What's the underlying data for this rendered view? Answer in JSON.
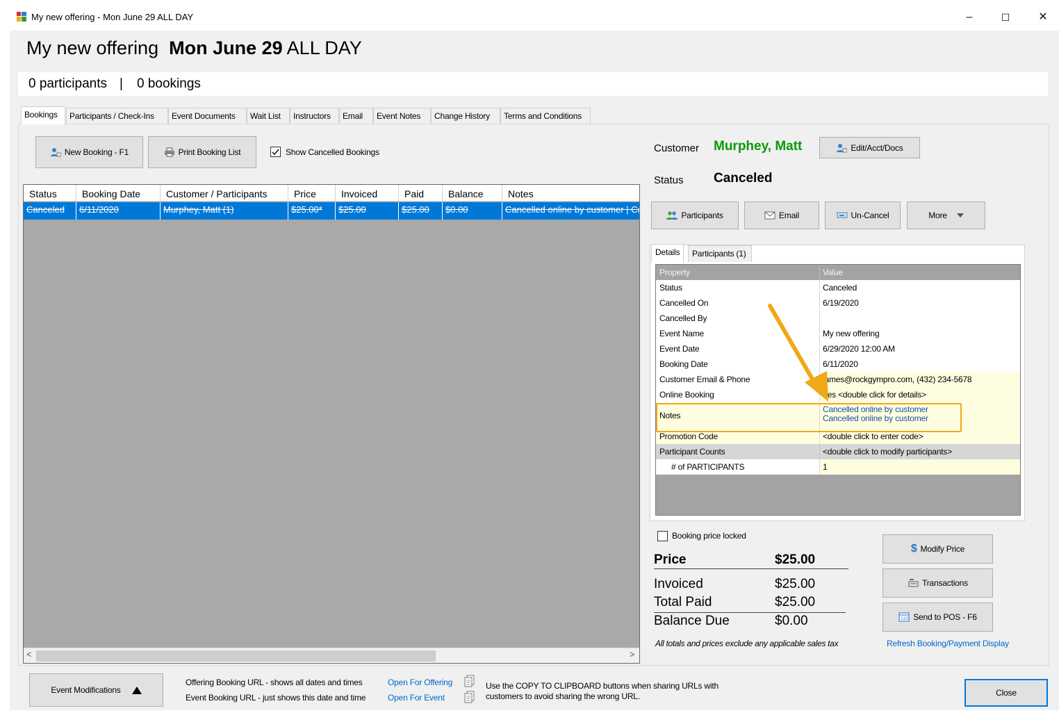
{
  "window": {
    "title": "My new offering - Mon June 29 ALL DAY",
    "minimize": "–",
    "maximize": "☐",
    "close": "✕"
  },
  "header": {
    "offering_name": "My new offering",
    "date": "Mon June 29",
    "time": "ALL DAY",
    "participants_count": "0 participants",
    "separator": "|",
    "bookings_count": "0 bookings"
  },
  "tabs": [
    "Bookings",
    "Participants / Check-Ins",
    "Event Documents",
    "Wait List",
    "Instructors",
    "Email",
    "Event Notes",
    "Change History",
    "Terms and Conditions"
  ],
  "toolbar": {
    "new_booking": "New Booking - F1",
    "print_list": "Print Booking List",
    "show_cancelled": "Show Cancelled Bookings",
    "show_cancelled_checked": true
  },
  "bookings_grid": {
    "columns": [
      "Status",
      "Booking Date",
      "Customer / Participants",
      "Price",
      "Invoiced",
      "Paid",
      "Balance",
      "Notes"
    ],
    "rows": [
      [
        "Canceled",
        "6/11/2020",
        "Murphey, Matt (1)",
        "$25.00*",
        "$25.00",
        "$25.00",
        "$0.00",
        "Cancelled online by customer | Cancelled online by customer"
      ]
    ]
  },
  "customer": {
    "label": "Customer",
    "name": "Murphey, Matt",
    "edit_button": "Edit/Acct/Docs",
    "status_label": "Status",
    "status": "Canceled"
  },
  "actions": {
    "participants": "Participants",
    "email": "Email",
    "uncancel": "Un-Cancel",
    "more": "More"
  },
  "detail_tabs": [
    "Details",
    "Participants (1)"
  ],
  "properties": {
    "header_property": "Property",
    "header_value": "Value",
    "rows": [
      {
        "k": "Status",
        "v": "Canceled"
      },
      {
        "k": "Cancelled On",
        "v": "6/19/2020"
      },
      {
        "k": "Cancelled By",
        "v": ""
      },
      {
        "k": "Event Name",
        "v": "My new offering"
      },
      {
        "k": "Event Date",
        "v": "6/29/2020 12:00 AM"
      },
      {
        "k": "Booking Date",
        "v": "6/11/2020"
      },
      {
        "k": "Customer Email & Phone",
        "v": "james@rockgympro.com, (432) 234-5678"
      },
      {
        "k": "Online Booking",
        "v": "Yes <double click for details>"
      }
    ],
    "notes_key": "Notes",
    "notes_line1": "Cancelled online by customer",
    "notes_line2": "Cancelled online by customer",
    "promo_key": "Promotion Code",
    "promo_val": "<double click to enter code>",
    "counts_key": "Participant Counts",
    "counts_val": "<double click to modify participants>",
    "num_key": "# of PARTICIPANTS",
    "num_val": "1"
  },
  "pricing": {
    "price_locked": "Booking price locked",
    "price_label": "Price",
    "price": "$25.00",
    "invoiced_label": "Invoiced",
    "invoiced": "$25.00",
    "paid_label": "Total Paid",
    "paid": "$25.00",
    "balance_label": "Balance Due",
    "balance": "$0.00",
    "tax_note": "All totals and prices exclude any applicable sales tax",
    "modify_price": "Modify Price",
    "transactions": "Transactions",
    "send_pos": "Send to POS - F6",
    "refresh": "Refresh Booking/Payment Display"
  },
  "footer": {
    "event_mods": "Event Modifications",
    "offering_url": "Offering Booking URL - shows all dates and times",
    "open_offering": "Open For Offering",
    "event_url": "Event Booking URL - just shows this date and time",
    "open_event": "Open For Event",
    "clipboard_note_1": "Use the COPY TO CLIPBOARD buttons when sharing URLs with",
    "clipboard_note_2": "customers to avoid sharing the wrong URL.",
    "close": "Close"
  },
  "colors": {
    "accent_green": "#0a9a0a",
    "selection_blue": "#0078d7",
    "highlight_orange": "#f0a818",
    "link_blue": "#0066cc"
  }
}
